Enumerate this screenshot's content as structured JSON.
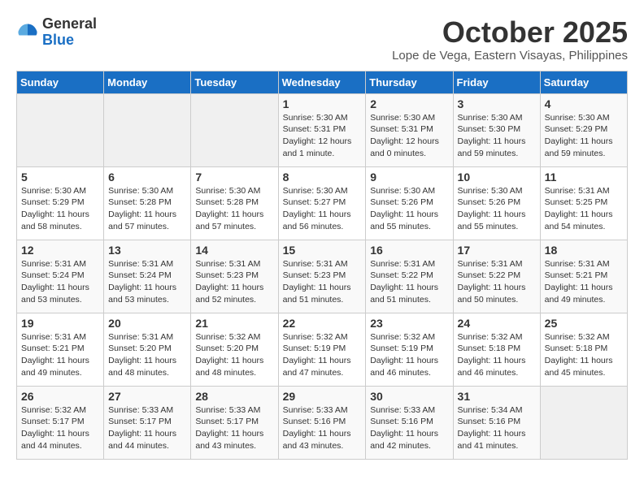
{
  "header": {
    "logo_general": "General",
    "logo_blue": "Blue",
    "month_title": "October 2025",
    "location": "Lope de Vega, Eastern Visayas, Philippines"
  },
  "weekdays": [
    "Sunday",
    "Monday",
    "Tuesday",
    "Wednesday",
    "Thursday",
    "Friday",
    "Saturday"
  ],
  "weeks": [
    [
      {
        "day": "",
        "info": ""
      },
      {
        "day": "",
        "info": ""
      },
      {
        "day": "",
        "info": ""
      },
      {
        "day": "1",
        "info": "Sunrise: 5:30 AM\nSunset: 5:31 PM\nDaylight: 12 hours\nand 1 minute."
      },
      {
        "day": "2",
        "info": "Sunrise: 5:30 AM\nSunset: 5:31 PM\nDaylight: 12 hours\nand 0 minutes."
      },
      {
        "day": "3",
        "info": "Sunrise: 5:30 AM\nSunset: 5:30 PM\nDaylight: 11 hours\nand 59 minutes."
      },
      {
        "day": "4",
        "info": "Sunrise: 5:30 AM\nSunset: 5:29 PM\nDaylight: 11 hours\nand 59 minutes."
      }
    ],
    [
      {
        "day": "5",
        "info": "Sunrise: 5:30 AM\nSunset: 5:29 PM\nDaylight: 11 hours\nand 58 minutes."
      },
      {
        "day": "6",
        "info": "Sunrise: 5:30 AM\nSunset: 5:28 PM\nDaylight: 11 hours\nand 57 minutes."
      },
      {
        "day": "7",
        "info": "Sunrise: 5:30 AM\nSunset: 5:28 PM\nDaylight: 11 hours\nand 57 minutes."
      },
      {
        "day": "8",
        "info": "Sunrise: 5:30 AM\nSunset: 5:27 PM\nDaylight: 11 hours\nand 56 minutes."
      },
      {
        "day": "9",
        "info": "Sunrise: 5:30 AM\nSunset: 5:26 PM\nDaylight: 11 hours\nand 55 minutes."
      },
      {
        "day": "10",
        "info": "Sunrise: 5:30 AM\nSunset: 5:26 PM\nDaylight: 11 hours\nand 55 minutes."
      },
      {
        "day": "11",
        "info": "Sunrise: 5:31 AM\nSunset: 5:25 PM\nDaylight: 11 hours\nand 54 minutes."
      }
    ],
    [
      {
        "day": "12",
        "info": "Sunrise: 5:31 AM\nSunset: 5:24 PM\nDaylight: 11 hours\nand 53 minutes."
      },
      {
        "day": "13",
        "info": "Sunrise: 5:31 AM\nSunset: 5:24 PM\nDaylight: 11 hours\nand 53 minutes."
      },
      {
        "day": "14",
        "info": "Sunrise: 5:31 AM\nSunset: 5:23 PM\nDaylight: 11 hours\nand 52 minutes."
      },
      {
        "day": "15",
        "info": "Sunrise: 5:31 AM\nSunset: 5:23 PM\nDaylight: 11 hours\nand 51 minutes."
      },
      {
        "day": "16",
        "info": "Sunrise: 5:31 AM\nSunset: 5:22 PM\nDaylight: 11 hours\nand 51 minutes."
      },
      {
        "day": "17",
        "info": "Sunrise: 5:31 AM\nSunset: 5:22 PM\nDaylight: 11 hours\nand 50 minutes."
      },
      {
        "day": "18",
        "info": "Sunrise: 5:31 AM\nSunset: 5:21 PM\nDaylight: 11 hours\nand 49 minutes."
      }
    ],
    [
      {
        "day": "19",
        "info": "Sunrise: 5:31 AM\nSunset: 5:21 PM\nDaylight: 11 hours\nand 49 minutes."
      },
      {
        "day": "20",
        "info": "Sunrise: 5:31 AM\nSunset: 5:20 PM\nDaylight: 11 hours\nand 48 minutes."
      },
      {
        "day": "21",
        "info": "Sunrise: 5:32 AM\nSunset: 5:20 PM\nDaylight: 11 hours\nand 48 minutes."
      },
      {
        "day": "22",
        "info": "Sunrise: 5:32 AM\nSunset: 5:19 PM\nDaylight: 11 hours\nand 47 minutes."
      },
      {
        "day": "23",
        "info": "Sunrise: 5:32 AM\nSunset: 5:19 PM\nDaylight: 11 hours\nand 46 minutes."
      },
      {
        "day": "24",
        "info": "Sunrise: 5:32 AM\nSunset: 5:18 PM\nDaylight: 11 hours\nand 46 minutes."
      },
      {
        "day": "25",
        "info": "Sunrise: 5:32 AM\nSunset: 5:18 PM\nDaylight: 11 hours\nand 45 minutes."
      }
    ],
    [
      {
        "day": "26",
        "info": "Sunrise: 5:32 AM\nSunset: 5:17 PM\nDaylight: 11 hours\nand 44 minutes."
      },
      {
        "day": "27",
        "info": "Sunrise: 5:33 AM\nSunset: 5:17 PM\nDaylight: 11 hours\nand 44 minutes."
      },
      {
        "day": "28",
        "info": "Sunrise: 5:33 AM\nSunset: 5:17 PM\nDaylight: 11 hours\nand 43 minutes."
      },
      {
        "day": "29",
        "info": "Sunrise: 5:33 AM\nSunset: 5:16 PM\nDaylight: 11 hours\nand 43 minutes."
      },
      {
        "day": "30",
        "info": "Sunrise: 5:33 AM\nSunset: 5:16 PM\nDaylight: 11 hours\nand 42 minutes."
      },
      {
        "day": "31",
        "info": "Sunrise: 5:34 AM\nSunset: 5:16 PM\nDaylight: 11 hours\nand 41 minutes."
      },
      {
        "day": "",
        "info": ""
      }
    ]
  ]
}
